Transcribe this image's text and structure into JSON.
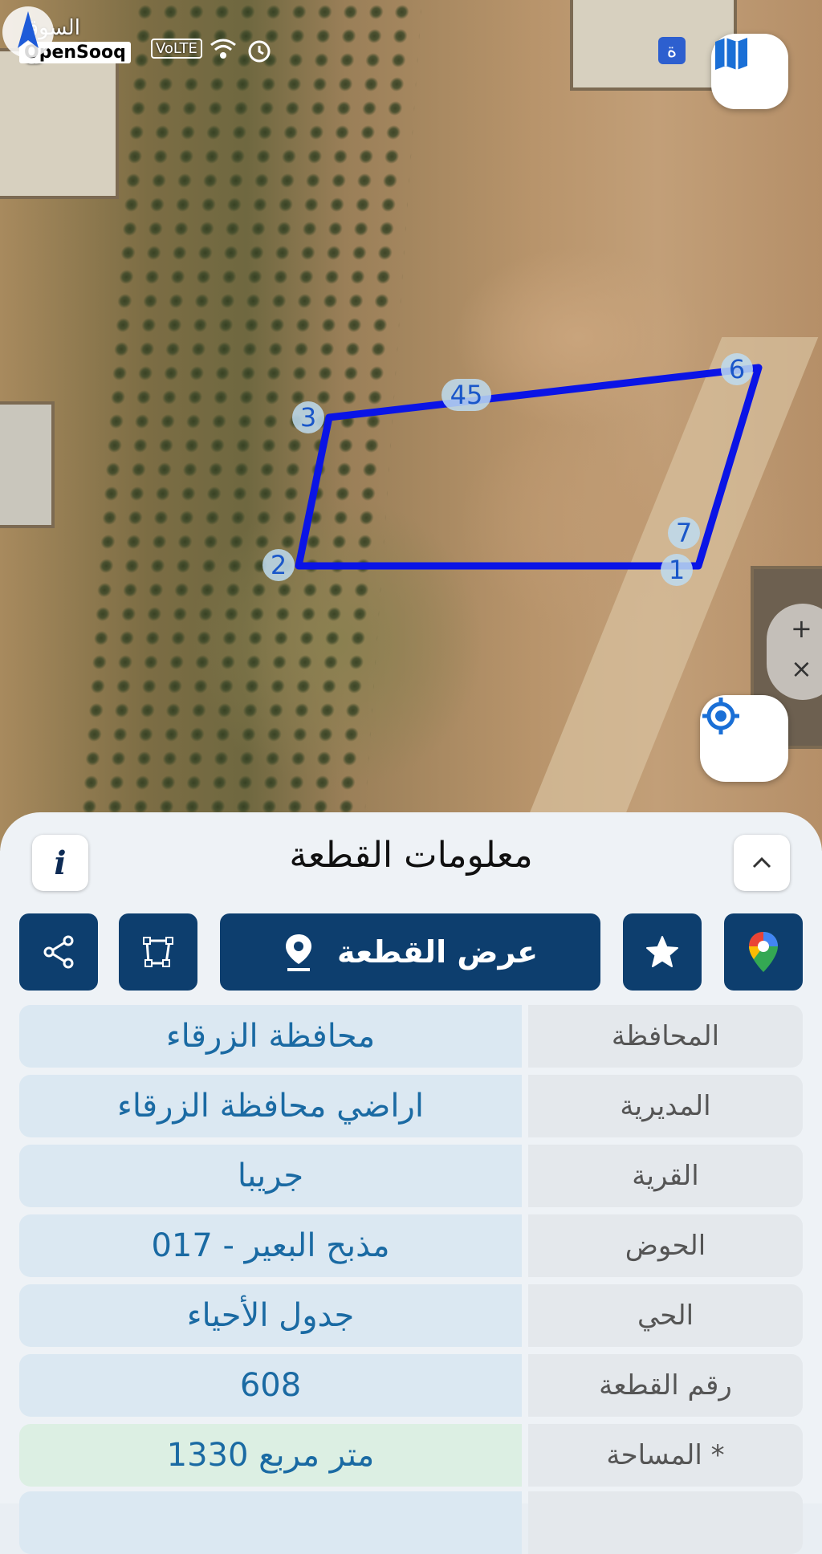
{
  "status_bar": {
    "brand_arabic": "السوق المفتوح",
    "brand_english": "OpenSooq",
    "volte": "VoLTE",
    "notif_badge": "ة"
  },
  "map": {
    "vertex_labels": [
      "1",
      "2",
      "3",
      "45",
      "6",
      "7"
    ],
    "zoom_in": "+",
    "zoom_close": "×"
  },
  "panel": {
    "title": "معلومات القطعة",
    "info_label": "i",
    "collapse_label": "˄",
    "show_parcel_label": "عرض القطعة"
  },
  "parcel_info": {
    "rows": [
      {
        "label": "المحافظة",
        "value": "محافظة الزرقاء"
      },
      {
        "label": "المديرية",
        "value": "اراضي محافظة الزرقاء"
      },
      {
        "label": "القرية",
        "value": "جريبا"
      },
      {
        "label": "الحوض",
        "value": "مذبح البعير - 017"
      },
      {
        "label": "الحي",
        "value": "جدول الأحياء"
      },
      {
        "label": "رقم القطعة",
        "value": "608"
      },
      {
        "label": "المساحة *",
        "value": "1330  متر مربع"
      }
    ]
  },
  "colors": {
    "navy": "#0d3e6e",
    "parcel_outline": "#0a14e6",
    "value_text": "#1a6aa3"
  }
}
